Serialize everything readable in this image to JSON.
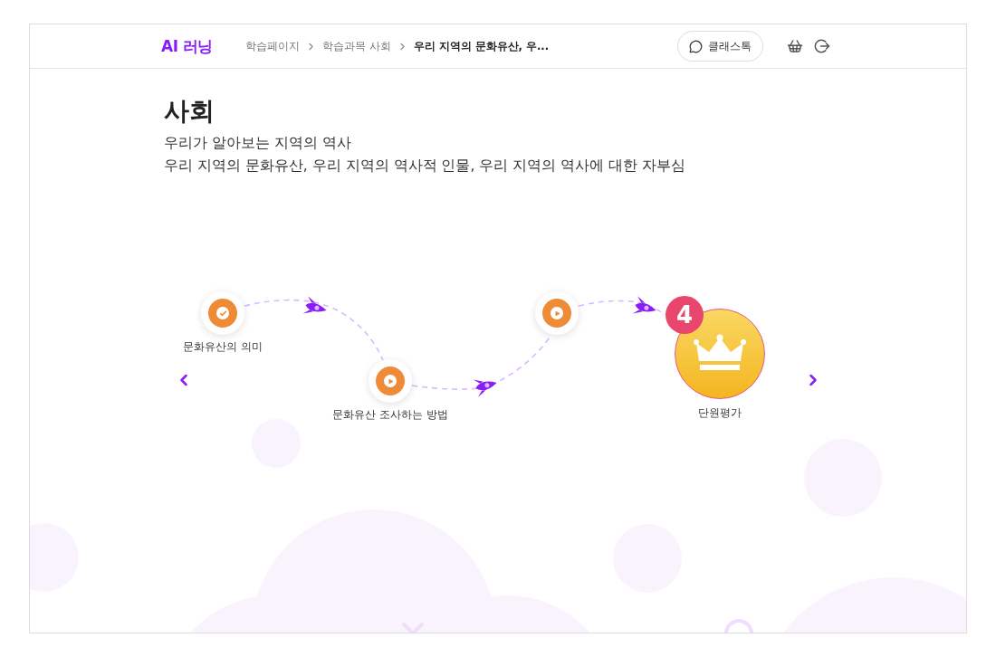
{
  "header": {
    "logo": "AI 러닝",
    "breadcrumbs": [
      {
        "label": "학습페이지",
        "current": false
      },
      {
        "label": "학습과목 사회",
        "current": false
      },
      {
        "label": "우리 지역의 문화유산, 우...",
        "current": true
      }
    ],
    "class_talk": "클래스톡"
  },
  "subject": {
    "title": "사회",
    "lines": [
      "우리가 알아보는 지역의 역사",
      "우리 지역의 문화유산, 우리 지역의 역사적 인물, 우리 지역의 역사에 대한 자부심"
    ]
  },
  "path": [
    {
      "kind": "completed",
      "label": "문화유산의 의미"
    },
    {
      "kind": "play",
      "label": "문화유산 조사하는 방법"
    },
    {
      "kind": "play"
    },
    {
      "kind": "exam",
      "badge": "4",
      "label": "단원평가"
    }
  ]
}
